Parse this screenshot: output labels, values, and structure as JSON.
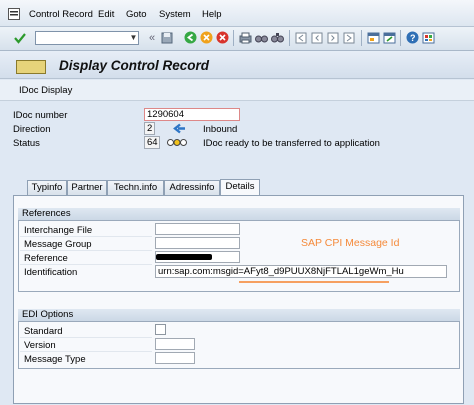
{
  "menu": {
    "items": [
      {
        "label": "Control Record"
      },
      {
        "label": "Edit"
      },
      {
        "label": "Goto"
      },
      {
        "label": "System"
      },
      {
        "label": "Help"
      }
    ]
  },
  "toolbar": {
    "command_value": ""
  },
  "title": {
    "text": "Display Control Record"
  },
  "app_toolbar": {
    "label": "IDoc Display"
  },
  "header": {
    "idoc_number": {
      "label": "IDoc number",
      "value": "1290604"
    },
    "direction": {
      "label": "Direction",
      "value": "2",
      "text": "Inbound"
    },
    "status": {
      "label": "Status",
      "value": "64",
      "text": "IDoc ready to be transferred to application"
    }
  },
  "tabs": [
    {
      "label": "Typinfo"
    },
    {
      "label": "Partner"
    },
    {
      "label": "Techn.info"
    },
    {
      "label": "Adressinfo"
    },
    {
      "label": "Details",
      "active": true
    }
  ],
  "references": {
    "title": "References",
    "interchange_file": {
      "label": "Interchange File",
      "value": ""
    },
    "message_group": {
      "label": "Message Group",
      "value": ""
    },
    "reference": {
      "label": "Reference",
      "value": ""
    },
    "identification": {
      "label": "Identification",
      "value": "urn:sap.com:msgid=AFyt8_d9PUUX8NjFTLAL1geWm_Hu"
    }
  },
  "annotation": {
    "text": "SAP CPI Message Id",
    "color": "#f58a3a"
  },
  "edi_options": {
    "title": "EDI Options",
    "standard": {
      "label": "Standard"
    },
    "version": {
      "label": "Version",
      "value": ""
    },
    "message_type": {
      "label": "Message Type",
      "value": ""
    }
  },
  "icons": [
    "menu-icon",
    "enter-icon",
    "save-icon",
    "back-icon",
    "exit-icon",
    "cancel-icon",
    "print-icon",
    "find-icon",
    "find-next-icon",
    "first-page-icon",
    "prev-page-icon",
    "next-page-icon",
    "last-page-icon",
    "new-session-icon",
    "shortcut-icon",
    "help-icon",
    "layout-icon",
    "inbound-arrow-icon",
    "status-traffic-light-icon"
  ]
}
